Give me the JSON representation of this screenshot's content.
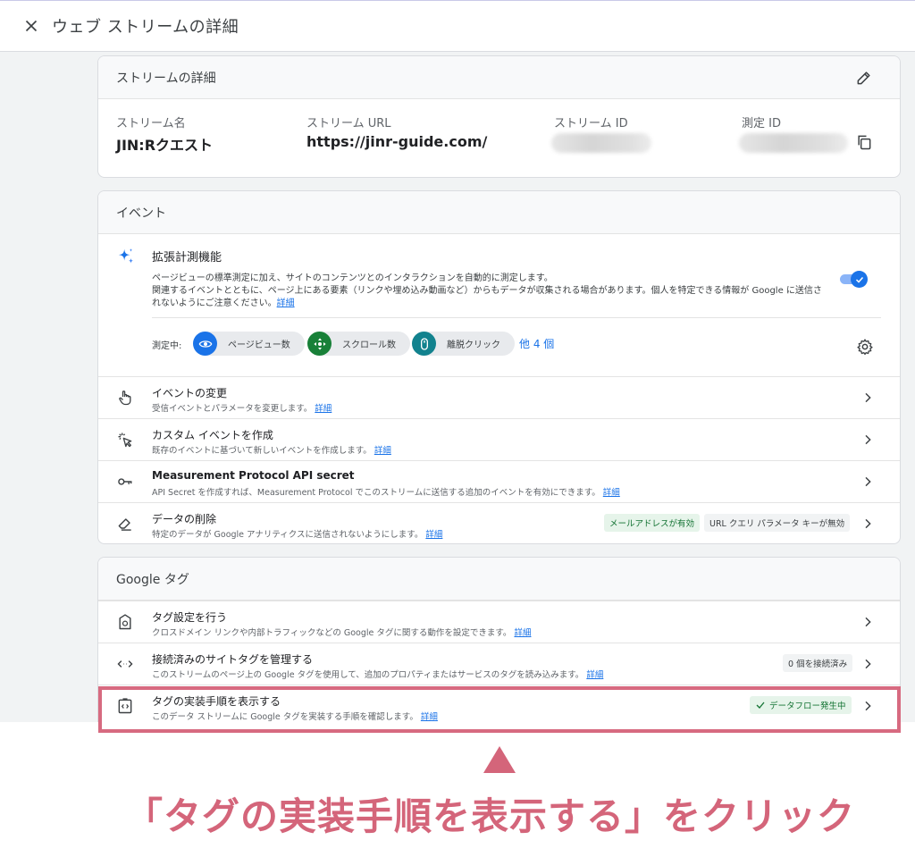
{
  "window": {
    "title": "ウェブ ストリームの詳細"
  },
  "stream_details": {
    "header": "ストリームの詳細",
    "name_label": "ストリーム名",
    "name_value": "JIN:Rクエスト",
    "url_label": "ストリーム URL",
    "url_value": "https://jinr-guide.com/",
    "id_label": "ストリーム ID",
    "measurement_label": "測定 ID"
  },
  "events": {
    "header": "イベント",
    "enhanced": {
      "title": "拡張計測機能",
      "desc_line1": "ページビューの標準測定に加え、サイトのコンテンツとのインタラクションを自動的に測定します。",
      "desc_line2": "関連するイベントとともに、ページ上にある要素（リンクや埋め込み動画など）からもデータが収集される場合があります。個人を特定できる情報が Google に送信さ",
      "desc_line3": "れないようにご注意ください。",
      "link": "詳細",
      "enabled": true,
      "measuring_label": "測定中:",
      "chips": [
        "ページビュー数",
        "スクロール数",
        "離脱クリック"
      ],
      "more_label": "他 4 個"
    },
    "rows": [
      {
        "title": "イベントの変更",
        "desc": "受信イベントとパラメータを変更します。",
        "link": "詳細",
        "icon": "touch-icon"
      },
      {
        "title": "カスタム イベントを作成",
        "desc": "既存のイベントに基づいて新しいイベントを作成します。",
        "link": "詳細",
        "icon": "cursor-click-icon"
      },
      {
        "title": "Measurement Protocol API secret",
        "desc": "API Secret を作成すれば、Measurement Protocol でこのストリームに送信する追加のイベントを有効にできます。",
        "link": "詳細",
        "icon": "key-icon"
      },
      {
        "title": "データの削除",
        "desc": "特定のデータが Google アナリティクスに送信されないようにします。",
        "link": "詳細",
        "icon": "eraser-icon",
        "badges": [
          "メールアドレスが有効",
          "URL クエリ パラメータ キーが無効"
        ]
      }
    ]
  },
  "google_tag": {
    "header": "Google タグ",
    "rows": [
      {
        "title": "タグ設定を行う",
        "desc": "クロスドメイン リンクや内部トラフィックなどの Google タグに関する動作を設定できます。",
        "link": "詳細",
        "icon": "tag-settings-icon"
      },
      {
        "title": "接続済みのサイトタグを管理する",
        "desc": "このストリームのページ上の Google タグを使用して、追加のプロパティまたはサービスのタグを読み込みます。",
        "link": "詳細",
        "icon": "code-icon",
        "badge": "0 個を接続済み"
      },
      {
        "title": "タグの実装手順を表示する",
        "desc": "このデータ ストリームに Google タグを実装する手順を確認します。",
        "link": "詳細",
        "icon": "tag-code-icon",
        "badge": "データフロー発生中"
      }
    ]
  },
  "annotation": {
    "caption": "「タグの実装手順を表示する」をクリック"
  },
  "colors": {
    "accent": "#1a73e8",
    "highlight": "#d76a80",
    "caption": "#d4657a",
    "success": "#137333"
  }
}
